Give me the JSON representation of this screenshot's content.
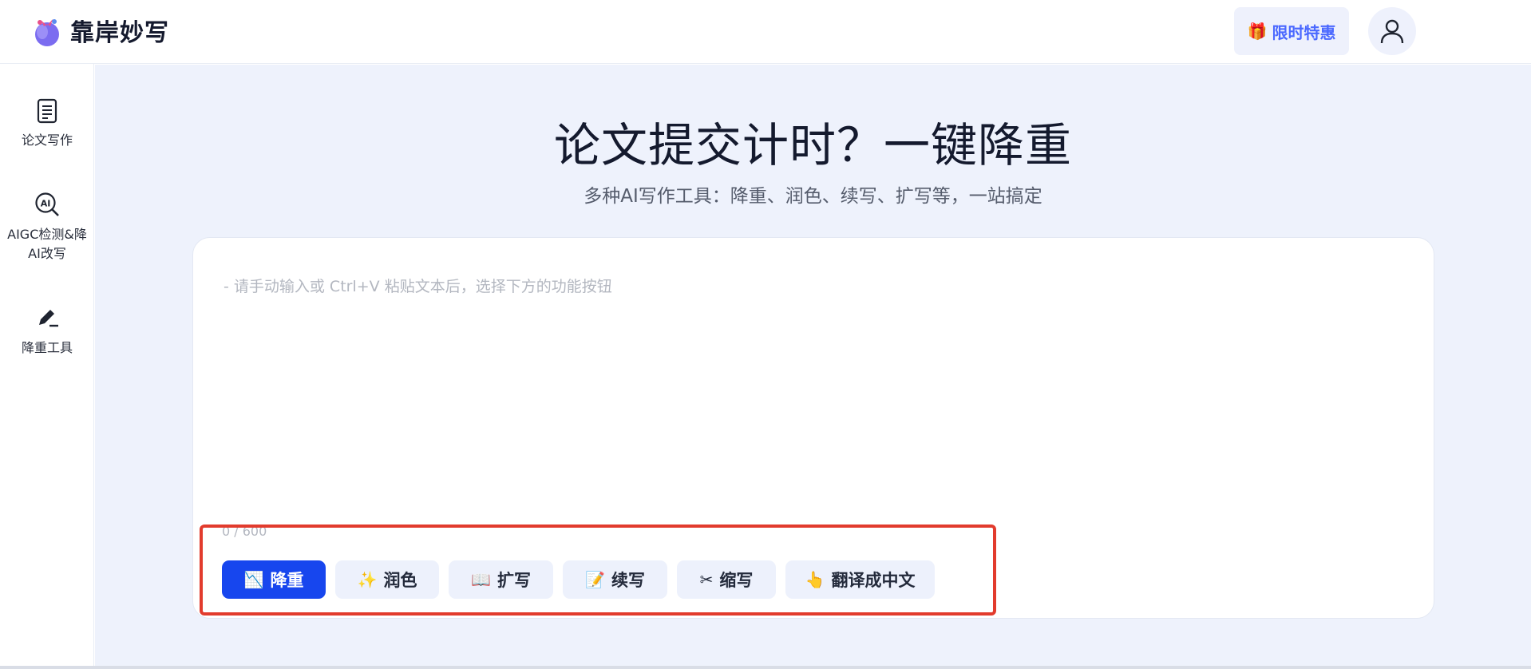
{
  "app": {
    "name": "靠岸妙写"
  },
  "header": {
    "promo_label": "限时特惠"
  },
  "sidebar": {
    "items": [
      {
        "label": "论文写作",
        "icon": "document-icon"
      },
      {
        "label": "AIGC检测&降AI改写",
        "icon": "ai-search-icon"
      },
      {
        "label": "降重工具",
        "icon": "pen-icon"
      }
    ]
  },
  "hero": {
    "title": "论文提交计时？一键降重",
    "subtitle": "多种AI写作工具：降重、润色、续写、扩写等，一站搞定"
  },
  "editor": {
    "placeholder": "- 请手动输入或 Ctrl+V 粘贴文本后，选择下方的功能按钮",
    "value": "",
    "counter": "0 / 600"
  },
  "tools": [
    {
      "label": "降重",
      "icon": "chart-icon",
      "active": true
    },
    {
      "label": "润色",
      "icon": "sparkle-icon",
      "active": false
    },
    {
      "label": "扩写",
      "icon": "book-icon",
      "active": false
    },
    {
      "label": "续写",
      "icon": "memo-icon",
      "active": false
    },
    {
      "label": "缩写",
      "icon": "scissors-icon",
      "active": false
    },
    {
      "label": "翻译成中文",
      "icon": "hand-icon",
      "active": false
    }
  ],
  "colors": {
    "accent": "#1746ee",
    "promo": "#4b69ff",
    "highlight": "#e23b2d",
    "page_bg": "#eef2fc"
  }
}
